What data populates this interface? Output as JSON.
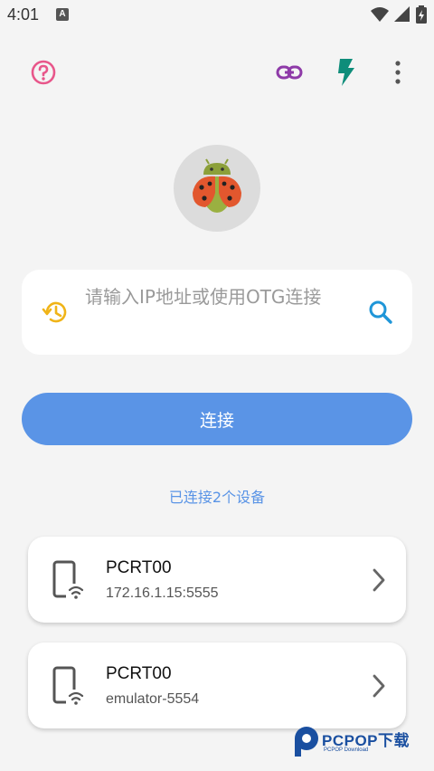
{
  "status_bar": {
    "time": "4:01",
    "a_icon": "A",
    "icons": [
      "wifi-icon",
      "signal-icon",
      "battery-icon"
    ]
  },
  "toolbar": {
    "help_icon": "help-circle-icon",
    "link_icon": "link-icon",
    "flash_icon": "flash-icon",
    "more_icon": "more-vert-icon"
  },
  "logo": {
    "icon": "ladybug-android-logo"
  },
  "search": {
    "placeholder": "请输入IP地址或使用OTG连接",
    "value": ""
  },
  "connect_button": {
    "label": "连接"
  },
  "connected_count": "已连接2个设备",
  "devices": [
    {
      "name": "PCRT00",
      "address": "172.16.1.15:5555"
    },
    {
      "name": "PCRT00",
      "address": "emulator-5554"
    }
  ],
  "watermark": {
    "text": "PCPOP下载",
    "sub": "PCPOP Download"
  },
  "colors": {
    "accent_blue": "#5a94e6",
    "help_pink": "#e8568a",
    "link_purple": "#8e3aa8",
    "flash_teal": "#0e8d7a",
    "history_yellow": "#f0b418",
    "search_blue": "#1f96d8"
  }
}
